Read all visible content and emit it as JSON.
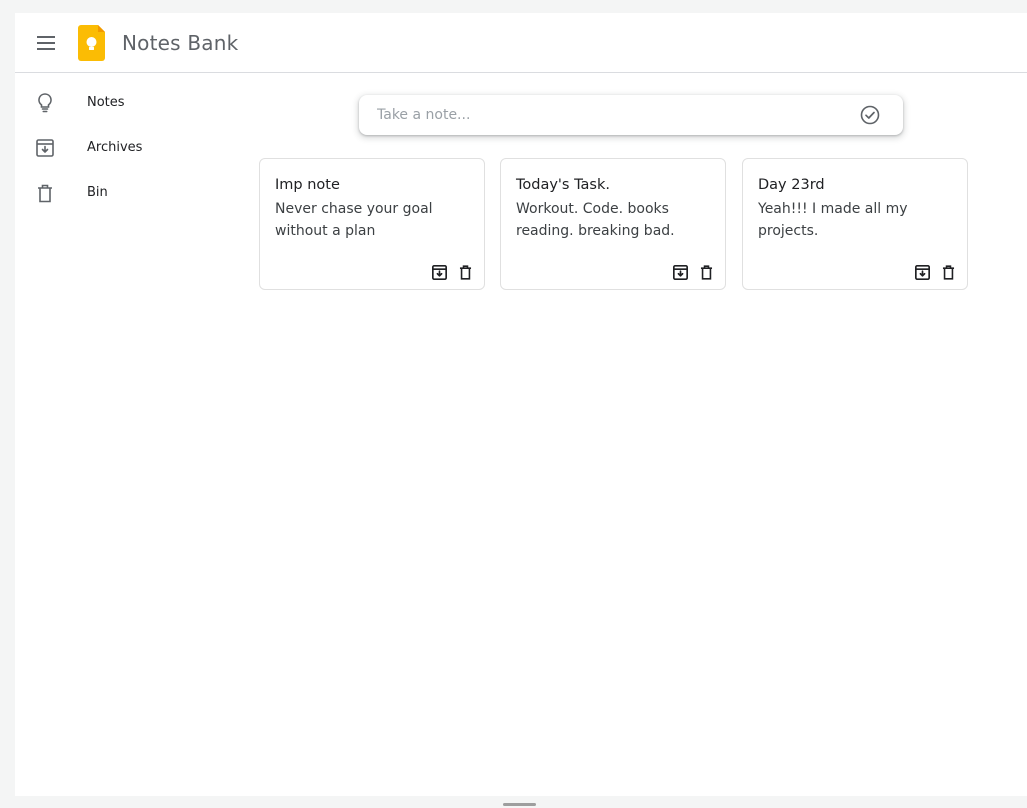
{
  "app": {
    "title": "Notes Bank",
    "brand_color": "#fbbc04"
  },
  "header": {
    "menu_icon": "hamburger-menu-icon",
    "logo_icon": "keep-bulb-logo"
  },
  "sidebar": {
    "items": [
      {
        "label": "Notes",
        "icon": "lightbulb-icon"
      },
      {
        "label": "Archives",
        "icon": "archive-icon"
      },
      {
        "label": "Bin",
        "icon": "trash-icon"
      }
    ]
  },
  "composer": {
    "placeholder": "Take a note...",
    "value": "",
    "confirm_icon": "check-circle-icon"
  },
  "notes": [
    {
      "title": "Imp note",
      "body": "Never chase your goal without a plan"
    },
    {
      "title": "Today's Task.",
      "body": "Workout. Code. books reading. breaking bad."
    },
    {
      "title": "Day 23rd",
      "body": "Yeah!!! I made all my projects."
    }
  ]
}
